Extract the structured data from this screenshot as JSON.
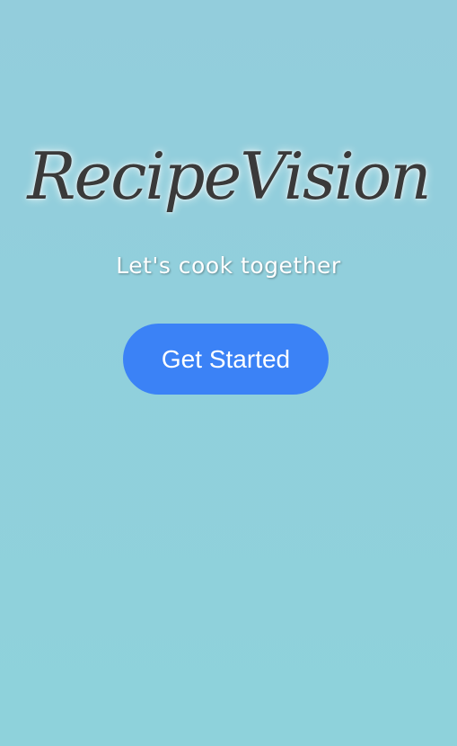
{
  "app": {
    "title": "RecipeVision",
    "tagline": "Let's cook together"
  },
  "actions": {
    "get_started_label": "Get Started"
  },
  "colors": {
    "background": "#8ed2db",
    "title_text": "#3a3a3a",
    "tagline_text": "#ffffff",
    "button_bg": "#3b82f6",
    "button_text": "#ffffff"
  }
}
